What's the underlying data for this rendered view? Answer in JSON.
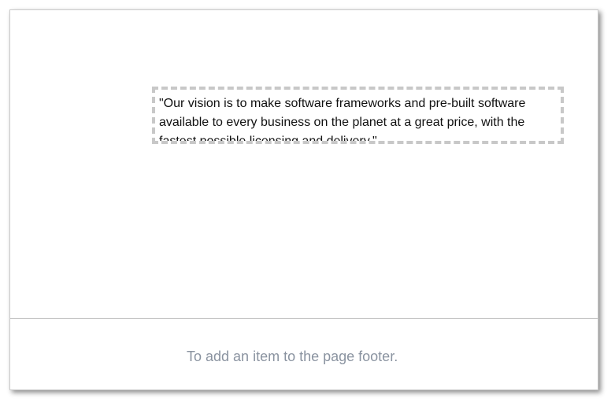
{
  "document": {
    "textbox": {
      "text": "\"Our vision is to make software frameworks and pre-built software available to every business on the planet at a great price, with the fastest possible licensing and delivery.\""
    },
    "footer": {
      "placeholder": "To add an item to the page footer."
    }
  },
  "colors": {
    "textbox_border": "#c8c8c8",
    "footer_hint": "#8a93a0",
    "divider": "#b8b8b8"
  }
}
